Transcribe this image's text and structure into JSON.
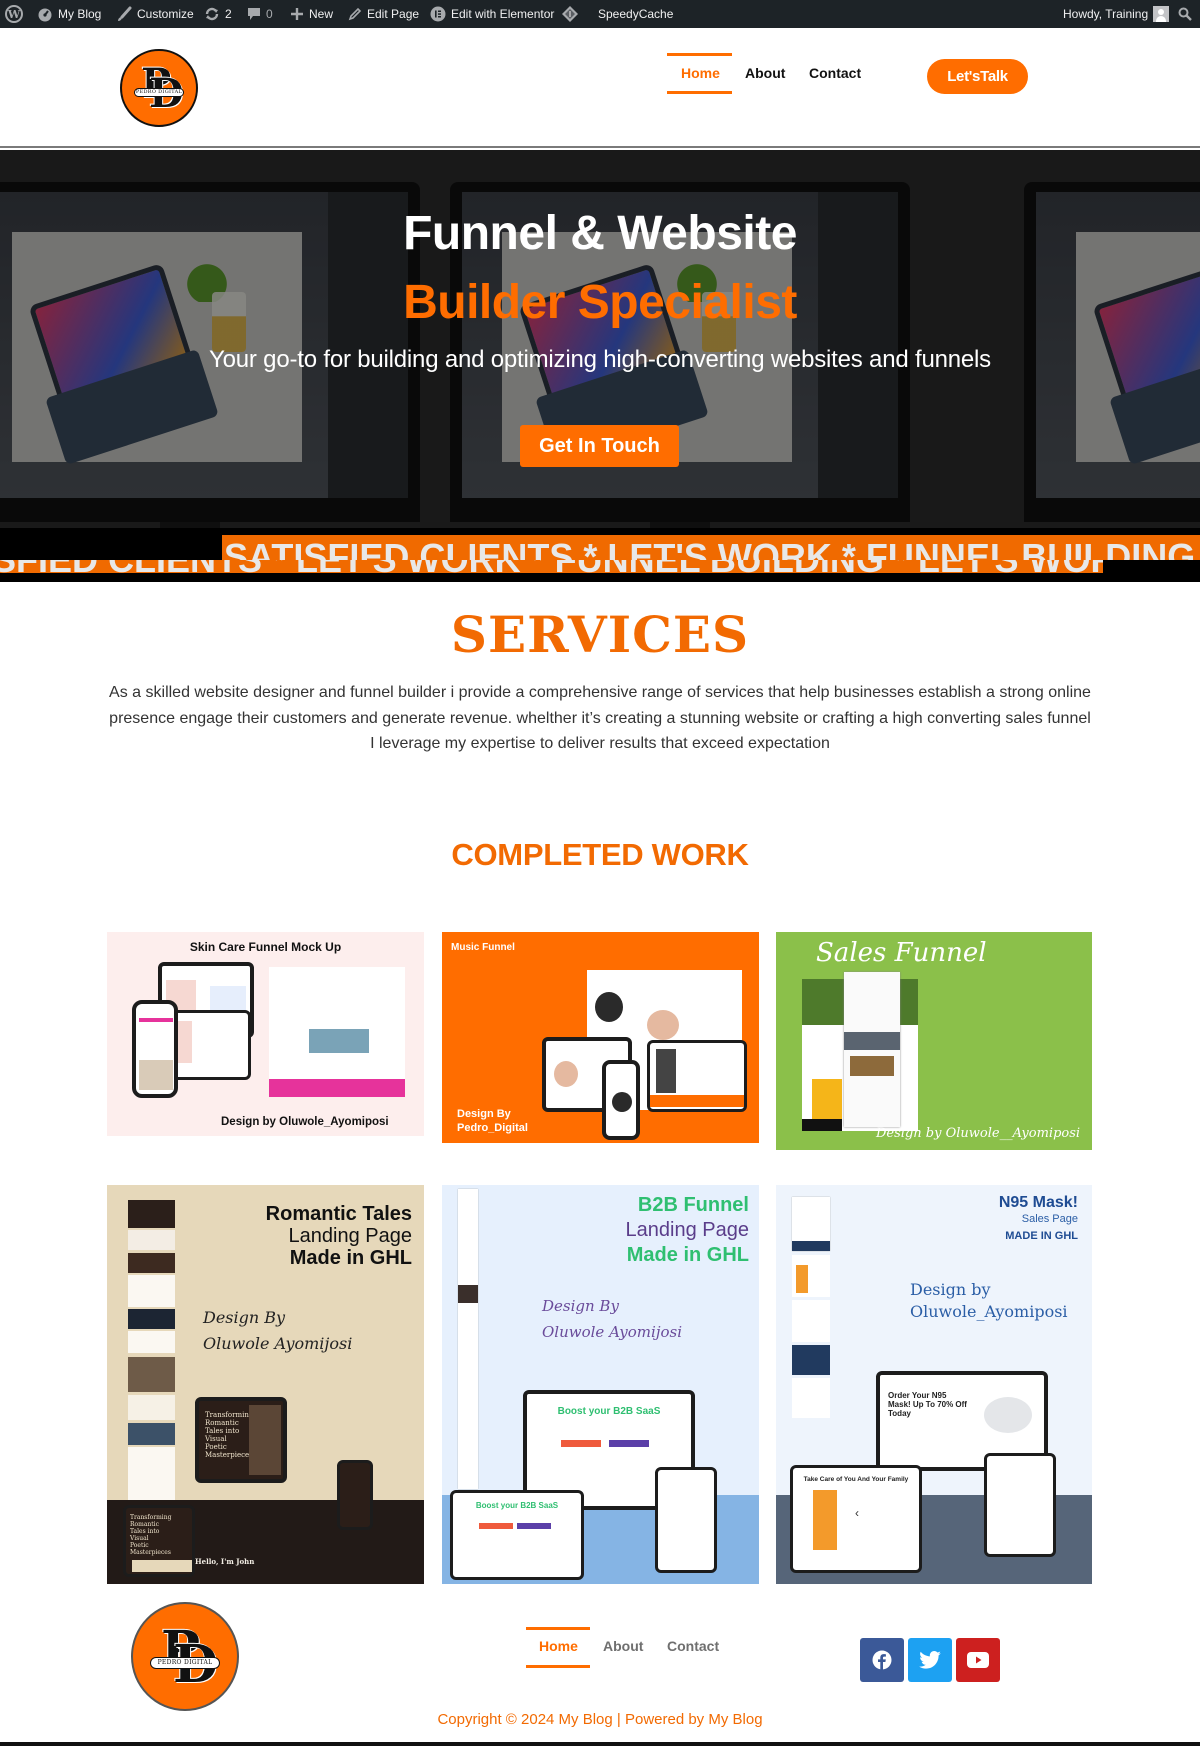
{
  "admin_bar": {
    "site_name": "My Blog",
    "customize": "Customize",
    "updates_count": "2",
    "comments_count": "0",
    "new_label": "New",
    "edit_page": "Edit Page",
    "edit_elementor": "Edit with Elementor",
    "speedycache": "SpeedyCache",
    "greeting": "Howdy, Training"
  },
  "header": {
    "logo_letters": "PD",
    "logo_band": "PEDRO DIGITAL",
    "nav": [
      {
        "label": "Home",
        "active": true
      },
      {
        "label": "About",
        "active": false
      },
      {
        "label": "Contact",
        "active": false
      }
    ],
    "cta_label": "Let'sTalk"
  },
  "hero": {
    "title_line1": "Funnel & Website",
    "title_line2": "Builder Specialist",
    "subtitle": "Your go-to for building and optimizing high-converting websites and funnels",
    "button_label": "Get In Touch"
  },
  "marquee": {
    "text_top": "SATISFIED CLIENTS * LET'S WORK * FUNNEL BUILDING * LET'S WORK",
    "text_bottom": "SFIED CLIENTS * LET'S WORK * FUNNEL BUILDING * LET'S WORK"
  },
  "services": {
    "title": "SERVICES",
    "description": "As a skilled website designer and funnel builder i provide a comprehensive range of services that help businesses establish a strong online presence engage their customers and generate revenue. whelther it’s creating a stunning website or crafting a high converting sales funnel I leverage my expertise to deliver results that exceed expectation"
  },
  "completed_work": {
    "title": "COMPLETED WORK",
    "items": [
      {
        "title": "Skin Care Funnel Mock Up",
        "credit": "Design by Oluwole_Ayomiposi"
      },
      {
        "title": "Music Funnel",
        "credit_line1": "Design By",
        "credit_line2": "Pedro_Digital"
      },
      {
        "title": "Sales Funnel",
        "credit": "Design by Oluwole__Ayomiposi"
      },
      {
        "title_line1": "Romantic Tales",
        "title_line2": "Landing Page",
        "title_line3": "Made in GHL",
        "credit_line1": "Design By",
        "credit_line2": "Oluwole   Ayomijosi",
        "screen_text": "Transforming Romantic Tales into Visual Poetic Masterpieces",
        "footer_text": "Hello, I'm John"
      },
      {
        "title_line1": "B2B Funnel",
        "title_line2": "Landing Page",
        "title_line3": "Made in GHL",
        "credit_line1": "Design By",
        "credit_line2": "Oluwole   Ayomijosi",
        "screen_text": "Boost your B2B SaaS"
      },
      {
        "title_line1": "N95 Mask!",
        "title_line2": "Sales Page",
        "title_line3": "MADE IN GHL",
        "credit_line1": "Design by",
        "credit_line2": "Oluwole_Ayomiposi",
        "screen_text": "Order Your N95 Mask! Up To 70% Off Today",
        "laptop_text": "Take Care of You And Your Family"
      }
    ]
  },
  "footer": {
    "nav": [
      {
        "label": "Home",
        "active": true
      },
      {
        "label": "About",
        "active": false
      },
      {
        "label": "Contact",
        "active": false
      }
    ],
    "social": [
      {
        "name": "facebook",
        "color": "#3b5998"
      },
      {
        "name": "twitter",
        "color": "#1da1f2"
      },
      {
        "name": "youtube",
        "color": "#cd201f"
      }
    ],
    "copyright": "Copyright © 2024 My Blog | Powered by My Blog"
  },
  "colors": {
    "accent": "#ff6d00",
    "admin_bar": "#1d2327"
  }
}
